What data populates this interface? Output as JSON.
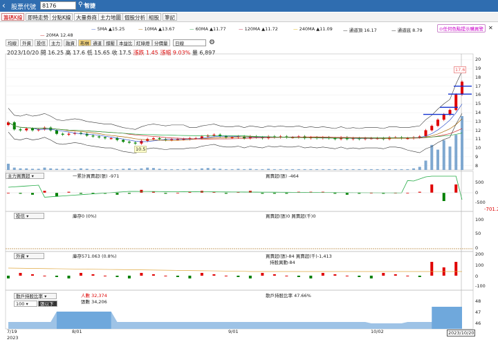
{
  "topbar": {
    "label": "股票代號",
    "code": "8176",
    "smart": "智捷"
  },
  "tabs": [
    "籌碼K線",
    "即時走勢",
    "分點K線",
    "大量券商",
    "主力地圖",
    "個股分析",
    "組股",
    "筆記"
  ],
  "warn": "⊙任何色點提示購買警",
  "ma_legend": [
    {
      "text": "5MA ▲15.25",
      "color": "#3355cc"
    },
    {
      "text": "10MA ▲13.67",
      "color": "#aa6600"
    },
    {
      "text": "60MA ▲11.77",
      "color": "#22aa44"
    },
    {
      "text": "120MA ▲11.72",
      "color": "#cc2244"
    },
    {
      "text": "240MA ▲11.09",
      "color": "#e0b000"
    },
    {
      "text": "通道頂 16.17",
      "color": "#444444"
    },
    {
      "text": "通道底 8.79",
      "color": "#444444"
    },
    {
      "text": "20MA 12.48",
      "color": "#cc2222"
    }
  ],
  "funcs": [
    "均線",
    "外資",
    "投信",
    "主力",
    "融資",
    "布林",
    "通道",
    "撐壓",
    "本益比",
    "紅綠燈",
    "分價量"
  ],
  "period": "日線",
  "quote": {
    "date": "2023/10/20",
    "open": "開 16.25",
    "high": "高 17.6",
    "low": "低 15.65",
    "close": "收 17.5",
    "chg": "漲跌 1.45",
    "pct": "漲幅 9.03%",
    "vol": "量 6,897"
  },
  "price_labels": {
    "max": "17.6",
    "min": "10.5"
  },
  "y_price": [
    "20",
    "19",
    "18",
    "17",
    "16",
    "15",
    "14",
    "13",
    "12",
    "11",
    "10",
    "9",
    "8"
  ],
  "p1": {
    "name": "主力買賣超",
    "acc": "一累計買賣超(張) -971",
    "day": "買賣超(張) -464",
    "y": [
      "500",
      "0",
      "-500"
    ],
    "last": "-701.2"
  },
  "p2": {
    "name": "投信",
    "hold": "庫存0 (0%)",
    "day": "買賣超(張)0 買賣超(千)0",
    "y": [
      "100",
      "50",
      "0"
    ]
  },
  "p3": {
    "name": "外資",
    "hold": "庫存571.063 (0.8%)",
    "day": "買賣超(張)-84 買賣超(千)-1,413",
    "sub": "持股異動-84",
    "y": [
      "200",
      "100",
      "0",
      "-100"
    ]
  },
  "p4": {
    "name": "散戶持股比率",
    "people": "人數 32,374",
    "holders": "張數 34,206",
    "ratio": "散戶持股比率 47.66%",
    "num": "100",
    "below": "張以下",
    "y": [
      "48",
      "47",
      "46"
    ]
  },
  "xaxis": {
    "d1": "7/19",
    "d1b": "2023",
    "d2": "8/01",
    "d3": "9/01",
    "d4": "10/02",
    "cur": "2023/10/20"
  },
  "colors": {
    "up": "#e00000",
    "down": "#008000",
    "vol": "#7fa8d0"
  },
  "chart_data": {
    "type": "candlestick",
    "closes": [
      12.9,
      12.1,
      12.0,
      12.2,
      12.0,
      12.1,
      12.3,
      12.0,
      11.6,
      11.5,
      11.6,
      11.7,
      11.6,
      11.4,
      11.3,
      11.2,
      11.1,
      11.1,
      10.9,
      10.7,
      10.6,
      10.5,
      10.8,
      11.0,
      11.1,
      11.0,
      10.9,
      11.0,
      11.0,
      11.0,
      11.1,
      11.1,
      11.3,
      11.4,
      11.5,
      11.3,
      11.2,
      11.2,
      11.3,
      11.1,
      11.3,
      11.2,
      11.1,
      11.3,
      11.2,
      11.3,
      11.2,
      11.2,
      11.3,
      11.1,
      11.2,
      11.1,
      11.2,
      11.1,
      11.0,
      11.2,
      11.0,
      11.1,
      11.0,
      11.1,
      11.1,
      11.1,
      11.0,
      11.2,
      11.2,
      11.1,
      11.1,
      11.2,
      11.3,
      12.0,
      12.5,
      13.2,
      13.8,
      14.3,
      16.05,
      17.5
    ],
    "volumes": [
      800,
      300,
      200,
      200,
      150,
      150,
      300,
      200,
      150,
      150,
      150,
      100,
      200,
      150,
      100,
      100,
      100,
      100,
      100,
      150,
      200,
      100,
      200,
      300,
      250,
      150,
      100,
      100,
      100,
      100,
      150,
      100,
      200,
      250,
      200,
      150,
      100,
      100,
      150,
      100,
      150,
      100,
      100,
      150,
      100,
      100,
      100,
      100,
      100,
      100,
      100,
      100,
      100,
      100,
      100,
      100,
      100,
      100,
      100,
      100,
      100,
      100,
      100,
      100,
      100,
      100,
      100,
      200,
      400,
      1200,
      3200,
      2600,
      3800,
      3000,
      4500,
      6897
    ],
    "ylim": [
      7.5,
      20.5
    ]
  }
}
